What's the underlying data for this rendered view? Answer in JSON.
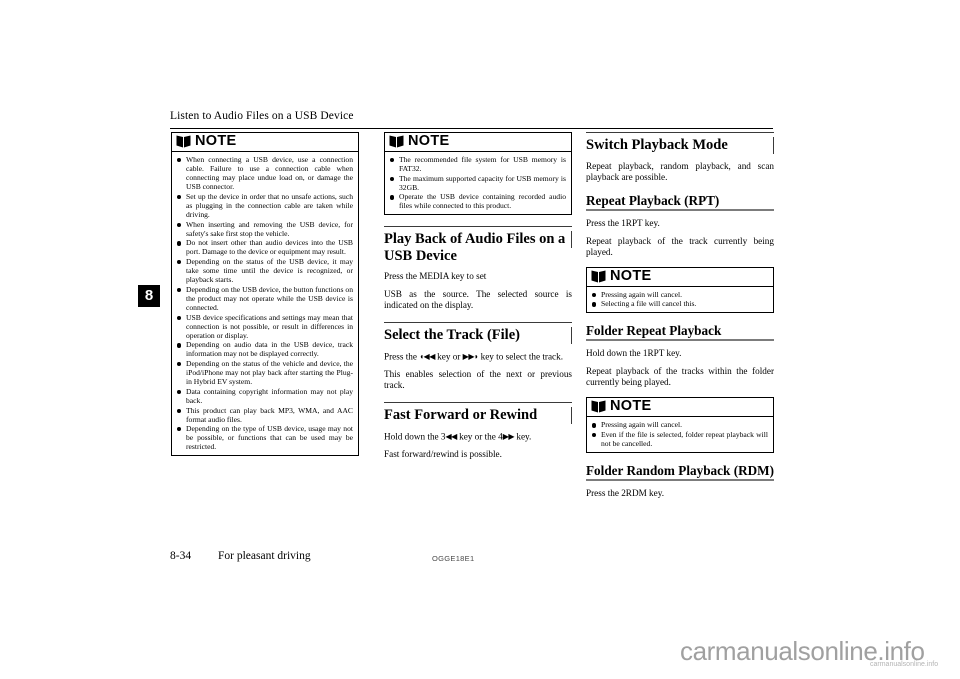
{
  "header": {
    "running_title": "Listen to Audio Files on a USB Device",
    "chapter_number": "8"
  },
  "footer": {
    "page_number": "8-34",
    "section_title": "For pleasant driving",
    "document_code": "OGGE18E1"
  },
  "watermark": {
    "main": "carmanualsonline.info",
    "small": "carmanualsonline.info"
  },
  "note_label": "NOTE",
  "column1": {
    "note1": {
      "title": "NOTE",
      "items": [
        "When connecting a USB device, use a connection cable. Failure to use a connection cable when connecting may place undue load on, or damage the USB connector.",
        "Set up the device in order that no unsafe actions, such as plugging in the connection cable are taken while driving.",
        "When inserting and removing the USB device, for safety's sake first stop the vehicle.",
        "Do not insert other than audio devices into the USB port. Damage to the device or equipment may result.",
        "Depending on the status of the USB device, it may take some time until the device is recognized, or playback starts.",
        "Depending on the USB device, the button functions on the product may not operate while the USB device is connected.",
        "USB device specifications and settings may mean that connection is not possible, or result in differences in operation or display.",
        "Depending on audio data in the USB device, track information may not be displayed correctly.",
        "Depending on the status of the vehicle and device, the iPod/iPhone may not play back after starting the Plug-in Hybrid EV system.",
        "Data containing copyright information may not play back.",
        "This product can play back MP3, WMA, and AAC format audio files.",
        "Depending on the type of USB device, usage may not be possible, or functions that can be used may be restricted."
      ]
    }
  },
  "column2": {
    "note1": {
      "title": "NOTE",
      "items": [
        "The recommended file system for USB memory is FAT32.",
        "The maximum supported capacity for USB memory is 32GB.",
        "Operate the USB device containing recorded audio files while connected to this product."
      ]
    },
    "heading_playback": "Play Back of Audio Files on a USB Device",
    "para_media_key": "Press the MEDIA key to set",
    "para_usb_source": "USB as the source. The selected source is indicated on the display.",
    "heading_select_track": "Select the Track (File)",
    "para_select_track_pre": "Press the",
    "para_select_track_mid": "key or",
    "para_select_track_post": "key to select the track.",
    "glyph_prev_track": "◖◀◀",
    "glyph_next_track": "▶▶◗",
    "para_select_enables": "This enables selection of the next or previous track.",
    "heading_fast_forward": "Fast Forward or Rewind",
    "para_ff_pre": "Hold down the 3",
    "para_ff_mid": "key or the 4",
    "para_ff_post": "key.",
    "glyph_rewind": "◀◀",
    "glyph_forward": "▶▶",
    "para_ff_possible": "Fast forward/rewind is possible."
  },
  "column3": {
    "heading_switch_mode": "Switch Playback Mode",
    "para_modes": "Repeat playback, random playback, and scan playback are possible.",
    "heading_repeat": "Repeat Playback (RPT)",
    "para_press_1rpt": "Press the 1RPT key.",
    "para_repeat_track": "Repeat playback of the track currently being played.",
    "note1": {
      "title": "NOTE",
      "items": [
        "Pressing again will cancel.",
        "Selecting a file will cancel this."
      ]
    },
    "heading_folder_repeat": "Folder Repeat Playback",
    "para_hold_1rpt": "Hold down the 1RPT key.",
    "para_repeat_folder": "Repeat playback of the tracks within the folder currently being played.",
    "note2": {
      "title": "NOTE",
      "items": [
        "Pressing again will cancel.",
        "Even if the file is selected, folder repeat playback will not be cancelled."
      ]
    },
    "heading_folder_random": "Folder Random Playback (RDM)",
    "para_press_2rdm": "Press the 2RDM key."
  }
}
